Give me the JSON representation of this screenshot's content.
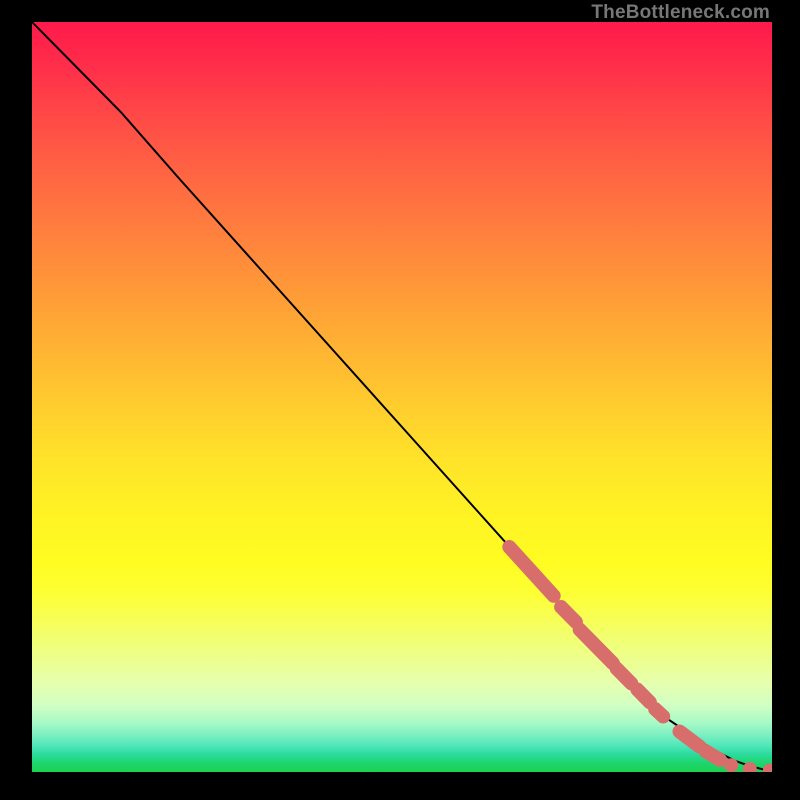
{
  "watermark": "TheBottleneck.com",
  "colors": {
    "line": "#000000",
    "dot_fill": "#d86e6b",
    "dot_stroke": "#c05a57",
    "background_black": "#000000"
  },
  "chart_data": {
    "type": "line",
    "title": "",
    "xlabel": "",
    "ylabel": "",
    "xlim": [
      0,
      100
    ],
    "ylim": [
      0,
      100
    ],
    "grid": false,
    "legend": false,
    "series": [
      {
        "name": "curve",
        "x": [
          0,
          3,
          7,
          12,
          20,
          30,
          40,
          50,
          60,
          70,
          76,
          82,
          86,
          89,
          92,
          95,
          97,
          99,
          100
        ],
        "y": [
          100,
          97,
          93,
          88,
          79,
          68,
          57,
          46,
          35,
          24,
          17,
          11,
          7,
          5,
          3,
          1.5,
          0.8,
          0.3,
          0.2
        ]
      }
    ],
    "highlight_segments": [
      {
        "x0": 64.5,
        "y0": 30.0,
        "x1": 70.5,
        "y1": 23.5
      },
      {
        "x0": 71.5,
        "y0": 22.0,
        "x1": 73.5,
        "y1": 20.0
      },
      {
        "x0": 74.0,
        "y0": 19.0,
        "x1": 78.5,
        "y1": 14.5
      },
      {
        "x0": 79.0,
        "y0": 13.8,
        "x1": 81.0,
        "y1": 11.8
      },
      {
        "x0": 81.8,
        "y0": 11.0,
        "x1": 83.5,
        "y1": 9.3
      },
      {
        "x0": 84.2,
        "y0": 8.4,
        "x1": 85.3,
        "y1": 7.4
      },
      {
        "x0": 87.5,
        "y0": 5.4,
        "x1": 90.2,
        "y1": 3.4
      },
      {
        "x0": 91.0,
        "y0": 2.8,
        "x1": 93.0,
        "y1": 1.6
      }
    ],
    "highlight_dots": [
      {
        "x": 94.5,
        "y": 0.9
      },
      {
        "x": 97.0,
        "y": 0.4
      },
      {
        "x": 99.7,
        "y": 0.2
      }
    ]
  }
}
